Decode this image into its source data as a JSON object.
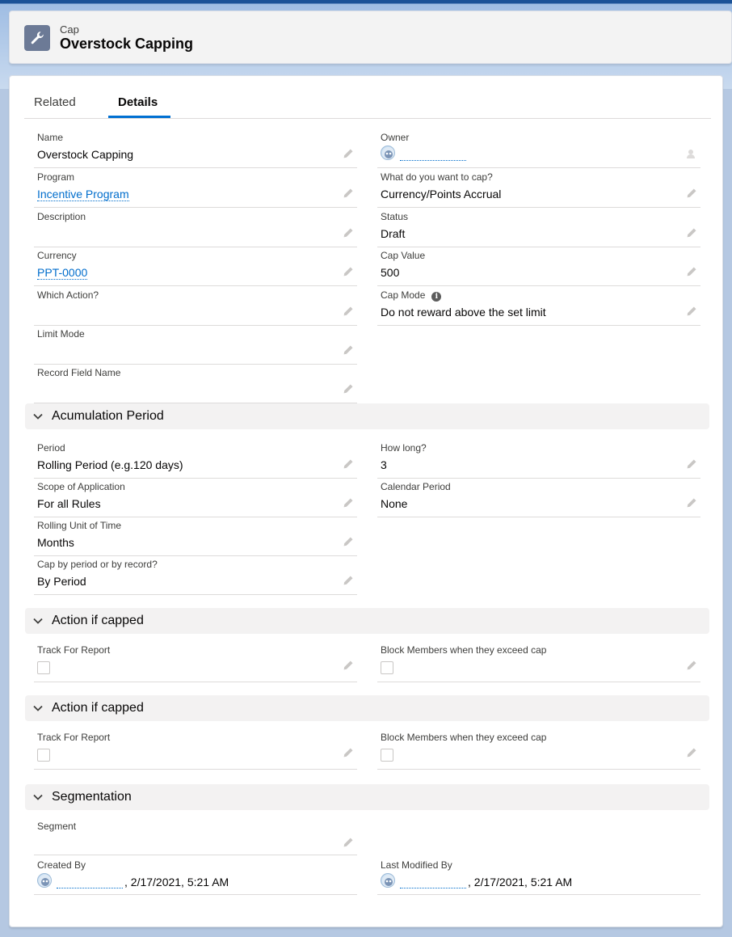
{
  "header": {
    "object_label": "Cap",
    "record_title": "Overstock Capping",
    "icon": "wrench-icon"
  },
  "tabs": [
    {
      "label": "Related",
      "active": false
    },
    {
      "label": "Details",
      "active": true
    }
  ],
  "colors": {
    "accent": "#0070d2",
    "link": "#006dcc",
    "header_icon_bg": "#6c7a96"
  },
  "details": {
    "name": {
      "label": "Name",
      "value": "Overstock Capping"
    },
    "owner": {
      "label": "Owner",
      "value": ""
    },
    "program": {
      "label": "Program",
      "value": "Incentive Program"
    },
    "what_cap": {
      "label": "What do you want to cap?",
      "value": "Currency/Points Accrual"
    },
    "description": {
      "label": "Description",
      "value": ""
    },
    "status": {
      "label": "Status",
      "value": "Draft"
    },
    "currency": {
      "label": "Currency",
      "value": "PPT-0000"
    },
    "cap_value": {
      "label": "Cap Value",
      "value": "500"
    },
    "which_action": {
      "label": "Which Action?",
      "value": ""
    },
    "cap_mode": {
      "label": "Cap Mode",
      "value": "Do not reward above the set limit",
      "info_icon": "i"
    },
    "limit_mode": {
      "label": "Limit Mode",
      "value": ""
    },
    "record_field_name": {
      "label": "Record Field Name",
      "value": ""
    }
  },
  "sections": {
    "accumulation": {
      "title": "Acumulation Period",
      "period": {
        "label": "Period",
        "value": "Rolling Period (e.g.120 days)"
      },
      "how_long": {
        "label": "How long?",
        "value": "3"
      },
      "scope": {
        "label": "Scope of Application",
        "value": "For all Rules"
      },
      "calendar_period": {
        "label": "Calendar Period",
        "value": "None"
      },
      "rolling_unit": {
        "label": "Rolling Unit of Time",
        "value": "Months"
      },
      "cap_by": {
        "label": "Cap by period or by record?",
        "value": "By Period"
      }
    },
    "action_capped_1": {
      "title": "Action if capped",
      "track": {
        "label": "Track For Report",
        "checked": false
      },
      "block": {
        "label": "Block Members when they exceed cap",
        "checked": false
      }
    },
    "action_capped_2": {
      "title": "Action if capped",
      "track": {
        "label": "Track For Report",
        "checked": false
      },
      "block": {
        "label": "Block Members when they exceed cap",
        "checked": false
      }
    },
    "segmentation": {
      "title": "Segmentation",
      "segment": {
        "label": "Segment",
        "value": ""
      },
      "created_by": {
        "label": "Created By",
        "date": ", 2/17/2021, 5:21 AM"
      },
      "last_modified_by": {
        "label": "Last Modified By",
        "date": ", 2/17/2021, 5:21 AM"
      }
    }
  }
}
